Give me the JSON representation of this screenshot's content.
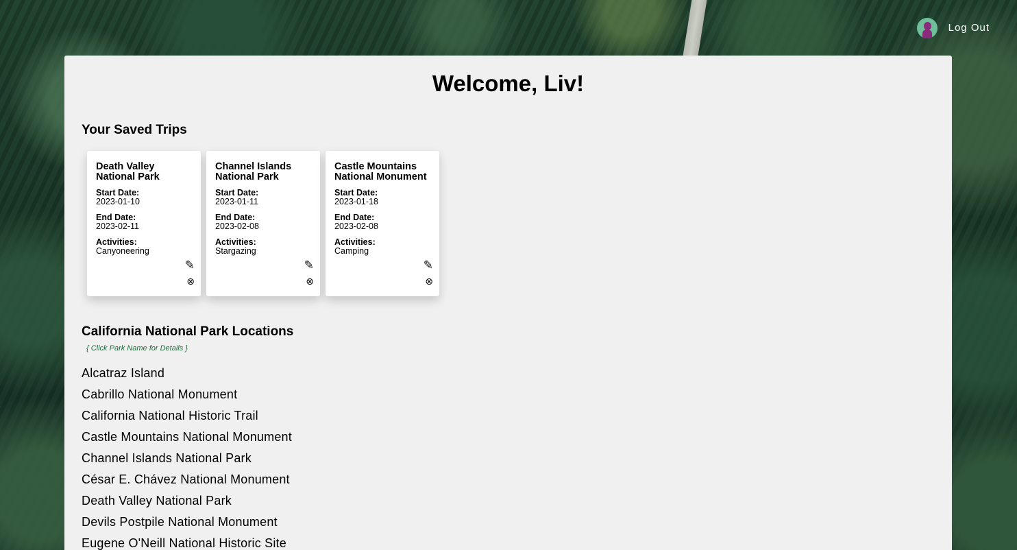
{
  "header": {
    "logout_label": "Log Out"
  },
  "welcome": "Welcome, Liv!",
  "saved_trips": {
    "title": "Your Saved Trips",
    "start_label": "Start Date:",
    "end_label": "End Date:",
    "activities_label": "Activities:",
    "trips": [
      {
        "park": "Death Valley National Park",
        "start": "2023-01-10",
        "end": "2023-02-11",
        "activities": "Canyoneering"
      },
      {
        "park": "Channel Islands National Park",
        "start": "2023-01-11",
        "end": "2023-02-08",
        "activities": "Stargazing"
      },
      {
        "park": "Castle Mountains National Monument",
        "start": "2023-01-18",
        "end": "2023-02-08",
        "activities": "Camping"
      }
    ]
  },
  "locations": {
    "title": "California National Park Locations",
    "hint": "{ Click Park Name for Details }",
    "parks": [
      "Alcatraz Island",
      "Cabrillo National Monument",
      "California National Historic Trail",
      "Castle Mountains National Monument",
      "Channel Islands National Park",
      "César E. Chávez National Monument",
      "Death Valley National Park",
      "Devils Postpile National Monument",
      "Eugene O'Neill National Historic Site"
    ]
  },
  "icons": {
    "edit": "pencil-icon",
    "delete": "circled-x-icon"
  },
  "colors": {
    "panel_bg": "#f0f0f0",
    "hint_text": "#1f6a3a",
    "avatar_bg": "#6fbf9a",
    "avatar_figure": "#8a2a7a"
  }
}
